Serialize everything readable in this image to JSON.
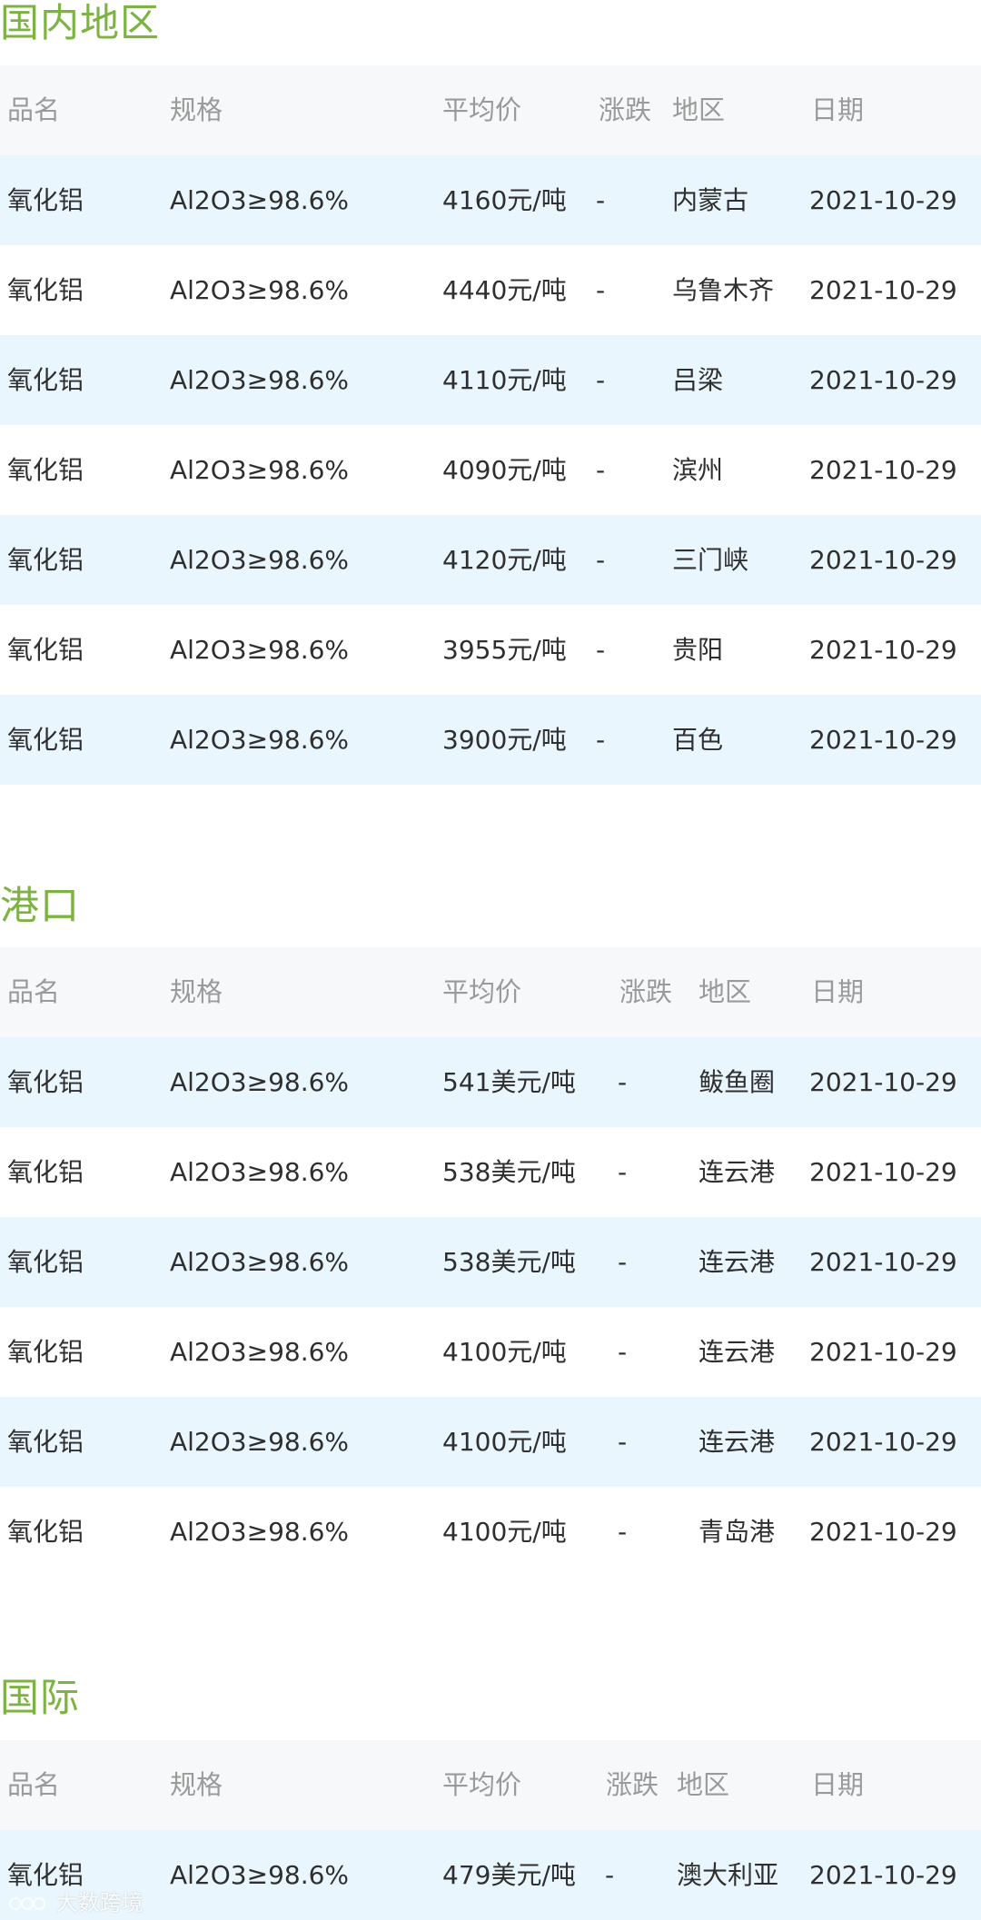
{
  "colors": {
    "section_title": "#7cb342",
    "header_bg": "#f6f8f9",
    "header_text": "#9a9a9a",
    "row_alt_bg": "#e9f6fd",
    "row_text": "#2f2f2f"
  },
  "sections": [
    {
      "title": "国内地区",
      "headers": [
        "品名",
        "规格",
        "平均价",
        "涨跌",
        "地区",
        "日期"
      ],
      "rows": [
        [
          "氧化铝",
          "Al2O3≥98.6%",
          "4160元/吨",
          "-",
          "内蒙古",
          "2021-10-29"
        ],
        [
          "氧化铝",
          "Al2O3≥98.6%",
          "4440元/吨",
          "-",
          "乌鲁木齐",
          "2021-10-29"
        ],
        [
          "氧化铝",
          "Al2O3≥98.6%",
          "4110元/吨",
          "-",
          "吕梁",
          "2021-10-29"
        ],
        [
          "氧化铝",
          "Al2O3≥98.6%",
          "4090元/吨",
          "-",
          "滨州",
          "2021-10-29"
        ],
        [
          "氧化铝",
          "Al2O3≥98.6%",
          "4120元/吨",
          "-",
          "三门峡",
          "2021-10-29"
        ],
        [
          "氧化铝",
          "Al2O3≥98.6%",
          "3955元/吨",
          "-",
          "贵阳",
          "2021-10-29"
        ],
        [
          "氧化铝",
          "Al2O3≥98.6%",
          "3900元/吨",
          "-",
          "百色",
          "2021-10-29"
        ]
      ]
    },
    {
      "title": "港口",
      "headers": [
        "品名",
        "规格",
        "平均价",
        "涨跌",
        "地区",
        "日期"
      ],
      "rows": [
        [
          "氧化铝",
          "Al2O3≥98.6%",
          "541美元/吨",
          "-",
          "鲅鱼圈",
          "2021-10-29"
        ],
        [
          "氧化铝",
          "Al2O3≥98.6%",
          "538美元/吨",
          "-",
          "连云港",
          "2021-10-29"
        ],
        [
          "氧化铝",
          "Al2O3≥98.6%",
          "538美元/吨",
          "-",
          "连云港",
          "2021-10-29"
        ],
        [
          "氧化铝",
          "Al2O3≥98.6%",
          "4100元/吨",
          "-",
          "连云港",
          "2021-10-29"
        ],
        [
          "氧化铝",
          "Al2O3≥98.6%",
          "4100元/吨",
          "-",
          "连云港",
          "2021-10-29"
        ],
        [
          "氧化铝",
          "Al2O3≥98.6%",
          "4100元/吨",
          "-",
          "青岛港",
          "2021-10-29"
        ]
      ]
    },
    {
      "title": "国际",
      "headers": [
        "品名",
        "规格",
        "平均价",
        "涨跌",
        "地区",
        "日期"
      ],
      "rows": [
        [
          "氧化铝",
          "Al2O3≥98.6%",
          "479美元/吨",
          "-",
          "澳大利亚",
          "2021-10-29"
        ]
      ]
    }
  ],
  "watermark": {
    "text": "大数跨境"
  }
}
